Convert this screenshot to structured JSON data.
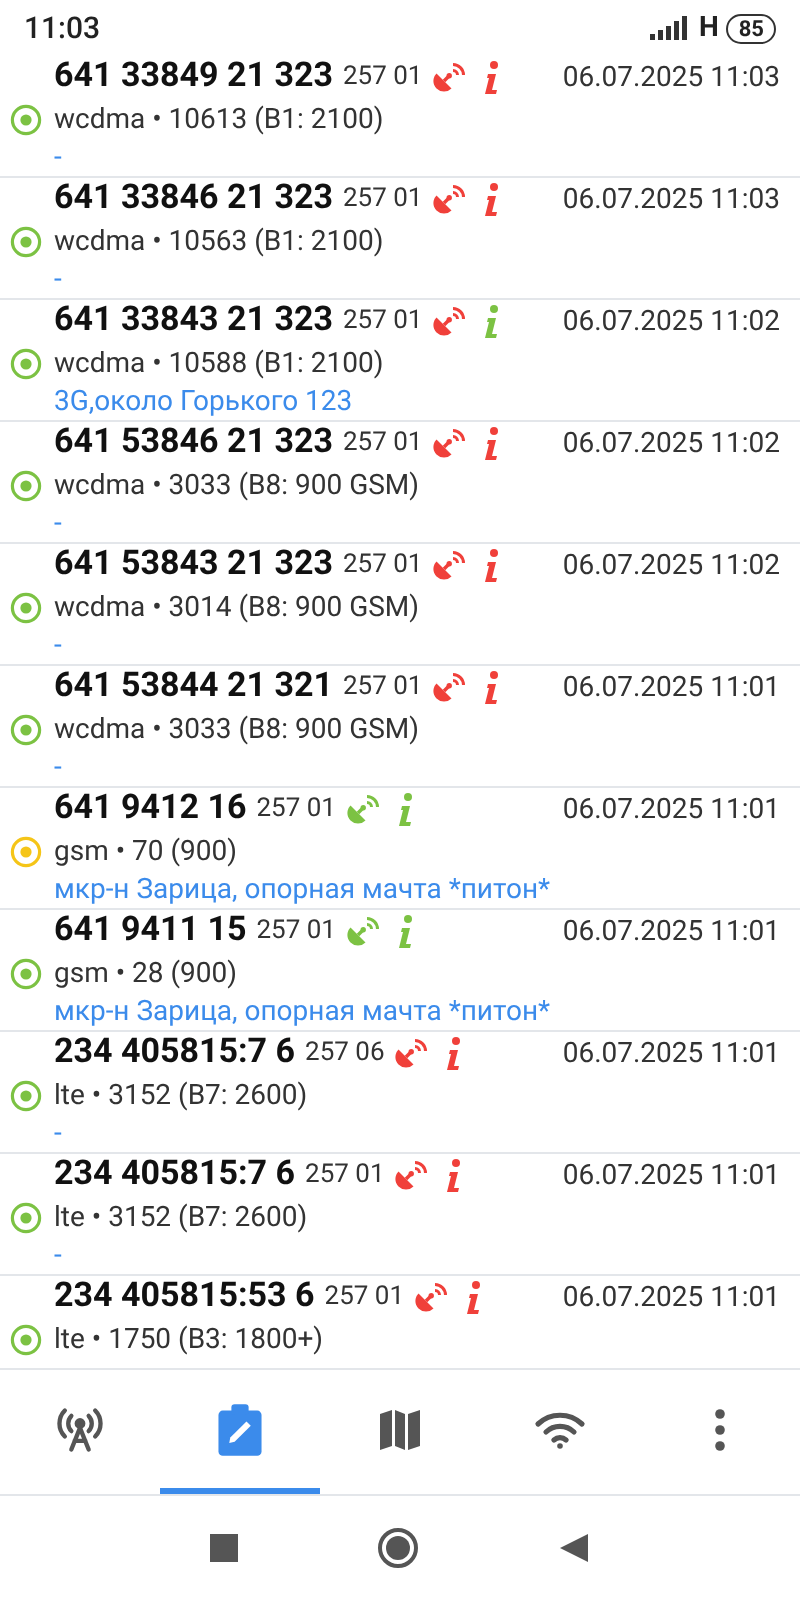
{
  "status_bar": {
    "time": "11:03",
    "network": "H",
    "battery": "85"
  },
  "cells": [
    {
      "cell_id": "641 33849 21 323",
      "mcc_mnc": "257 01",
      "known": false,
      "time": "06.07.2025 11:03",
      "color": "#7cc243",
      "tech": "wcdma • 10613 (B1: 2100)",
      "note": "-",
      "info_known": false
    },
    {
      "cell_id": "641 33846 21 323",
      "mcc_mnc": "257 01",
      "known": false,
      "time": "06.07.2025 11:03",
      "color": "#7cc243",
      "tech": "wcdma • 10563 (B1: 2100)",
      "note": "-",
      "info_known": false
    },
    {
      "cell_id": "641 33843 21 323",
      "mcc_mnc": "257 01",
      "known": false,
      "time": "06.07.2025 11:02",
      "color": "#7cc243",
      "tech": "wcdma • 10588 (B1: 2100)",
      "note": "3G,около Горького 123",
      "info_known": true
    },
    {
      "cell_id": "641 53846 21 323",
      "mcc_mnc": "257 01",
      "known": false,
      "time": "06.07.2025 11:02",
      "color": "#7cc243",
      "tech": "wcdma • 3033 (B8: 900 GSM)",
      "note": "-",
      "info_known": false
    },
    {
      "cell_id": "641 53843 21 323",
      "mcc_mnc": "257 01",
      "known": false,
      "time": "06.07.2025 11:02",
      "color": "#7cc243",
      "tech": "wcdma • 3014 (B8: 900 GSM)",
      "note": "-",
      "info_known": false
    },
    {
      "cell_id": "641 53844 21 321",
      "mcc_mnc": "257 01",
      "known": false,
      "time": "06.07.2025 11:01",
      "color": "#7cc243",
      "tech": "wcdma • 3033 (B8: 900 GSM)",
      "note": "-",
      "info_known": false
    },
    {
      "cell_id": "641 9412 16",
      "mcc_mnc": "257 01",
      "known": true,
      "time": "06.07.2025 11:01",
      "color": "#f5c518",
      "tech": "gsm • 70 (900)",
      "note": "мкр-н Зарица, опорная мачта *питон*",
      "info_known": true
    },
    {
      "cell_id": "641 9411 15",
      "mcc_mnc": "257 01",
      "known": true,
      "time": "06.07.2025 11:01",
      "color": "#7cc243",
      "tech": "gsm • 28 (900)",
      "note": "мкр-н Зарица, опорная мачта *питон*",
      "info_known": true
    },
    {
      "cell_id": "234 405815:7 6",
      "mcc_mnc": "257 06",
      "known": false,
      "time": "06.07.2025 11:01",
      "color": "#7cc243",
      "tech": "lte • 3152 (B7: 2600)",
      "note": "-",
      "info_known": false
    },
    {
      "cell_id": "234 405815:7 6",
      "mcc_mnc": "257 01",
      "known": false,
      "time": "06.07.2025 11:01",
      "color": "#7cc243",
      "tech": "lte • 3152 (B7: 2600)",
      "note": "-",
      "info_known": false
    },
    {
      "cell_id": "234 405815:53 6",
      "mcc_mnc": "257 01",
      "known": false,
      "time": "06.07.2025 11:01",
      "color": "#7cc243",
      "tech": "lte • 1750 (B3: 1800+)",
      "info_known": false
    }
  ],
  "nav_tabs": [
    {
      "kind": "tower",
      "selected": false
    },
    {
      "kind": "log",
      "selected": true
    },
    {
      "kind": "map",
      "selected": false
    },
    {
      "kind": "wifi",
      "selected": false
    },
    {
      "kind": "more",
      "selected": false
    }
  ]
}
